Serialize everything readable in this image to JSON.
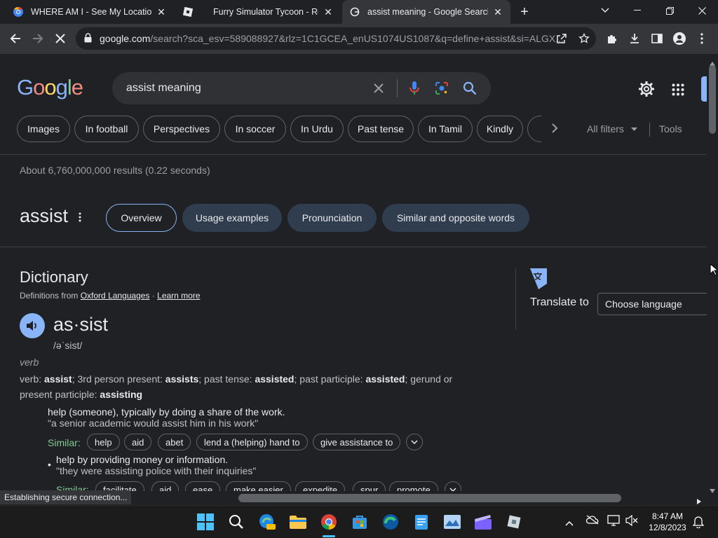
{
  "tabs": [
    {
      "title": "WHERE AM I - See My Location I",
      "favicon": "globe-icon",
      "active": false
    },
    {
      "title": "Furry Simulator Tycoon - Rob",
      "favicon": "roblox-icon",
      "active": false
    },
    {
      "title": "assist meaning - Google Search",
      "favicon": "google-icon",
      "active": true
    }
  ],
  "toolbar": {
    "url_domain": "google.com",
    "url_path": "/search?sca_esv=589088927&rlz=1C1GCEA_enUS1074US1087&q=define+assist&si=ALGX..."
  },
  "search": {
    "logo": "Google",
    "query": "assist meaning",
    "chips": [
      "Images",
      "In football",
      "Perspectives",
      "In soccer",
      "In Urdu",
      "Past tense",
      "In Tamil",
      "Kindly"
    ],
    "all_filters": "All filters",
    "tools": "Tools",
    "results_stats": "About 6,760,000,000 results (0.22 seconds)"
  },
  "word_panel": {
    "word": "assist",
    "pills": [
      "Overview",
      "Usage examples",
      "Pronunciation",
      "Similar and opposite words"
    ]
  },
  "dictionary": {
    "heading": "Dictionary",
    "source_prefix": "Definitions from",
    "source_link": "Oxford Languages",
    "separator": "·",
    "learn_more": "Learn more",
    "headword": "as·sist",
    "phonetic": "/əˈsist/",
    "pos": "verb",
    "forms": {
      "label": "verb:",
      "base": "assist",
      "t1": "; 3rd person present:",
      "third": "assists",
      "t2": "; past tense:",
      "past": "assisted",
      "t3": "; past participle:",
      "pp": "assisted",
      "t4": "; gerund or present participle:",
      "ger": "assisting"
    },
    "sense1": {
      "def": "help (someone), typically by doing a share of the work.",
      "example": "\"a senior academic would assist him in his work\"",
      "similar_label": "Similar:",
      "similar": [
        "help",
        "aid",
        "abet",
        "lend a (helping) hand to",
        "give assistance to"
      ]
    },
    "sense2": {
      "def": "help by providing money or information.",
      "example": "\"they were assisting police with their inquiries\"",
      "similar_label": "Similar:",
      "similar": [
        "facilitate",
        "aid",
        "ease",
        "make easier",
        "expedite",
        "spur",
        "promote"
      ]
    }
  },
  "translate": {
    "label": "Translate to",
    "placeholder": "Choose language"
  },
  "status": "Establishing secure connection...",
  "clock": {
    "time": "8:47 AM",
    "date": "12/8/2023"
  },
  "colors": {
    "accent": "#8ab4f8",
    "similar_green": "#81c995",
    "link": "#e8eaed"
  }
}
